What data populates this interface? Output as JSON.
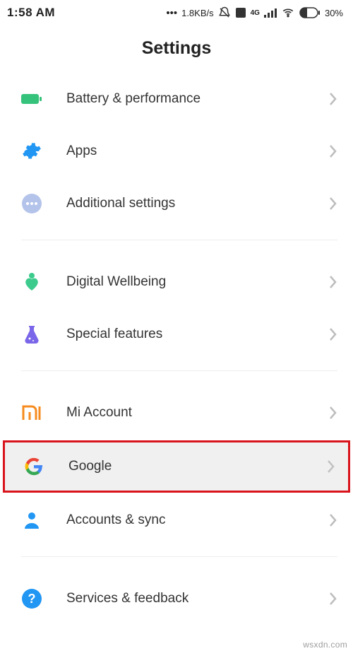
{
  "status": {
    "time": "1:58 AM",
    "speed": "1.8KB/s",
    "battery_pct": "30%"
  },
  "header": {
    "title": "Settings"
  },
  "groups": [
    {
      "items": [
        {
          "id": "battery",
          "label": "Battery & performance",
          "icon": "battery-icon"
        },
        {
          "id": "apps",
          "label": "Apps",
          "icon": "gear-icon"
        },
        {
          "id": "additional",
          "label": "Additional settings",
          "icon": "dots-icon"
        }
      ]
    },
    {
      "items": [
        {
          "id": "wellbeing",
          "label": "Digital Wellbeing",
          "icon": "wellbeing-icon"
        },
        {
          "id": "special",
          "label": "Special features",
          "icon": "flask-icon"
        }
      ]
    },
    {
      "items": [
        {
          "id": "mi",
          "label": "Mi Account",
          "icon": "mi-icon"
        },
        {
          "id": "google",
          "label": "Google",
          "icon": "google-icon",
          "highlighted": true
        },
        {
          "id": "accounts",
          "label": "Accounts & sync",
          "icon": "person-icon"
        }
      ]
    },
    {
      "items": [
        {
          "id": "services",
          "label": "Services & feedback",
          "icon": "help-icon"
        }
      ]
    }
  ],
  "watermark": "wsxdn.com"
}
